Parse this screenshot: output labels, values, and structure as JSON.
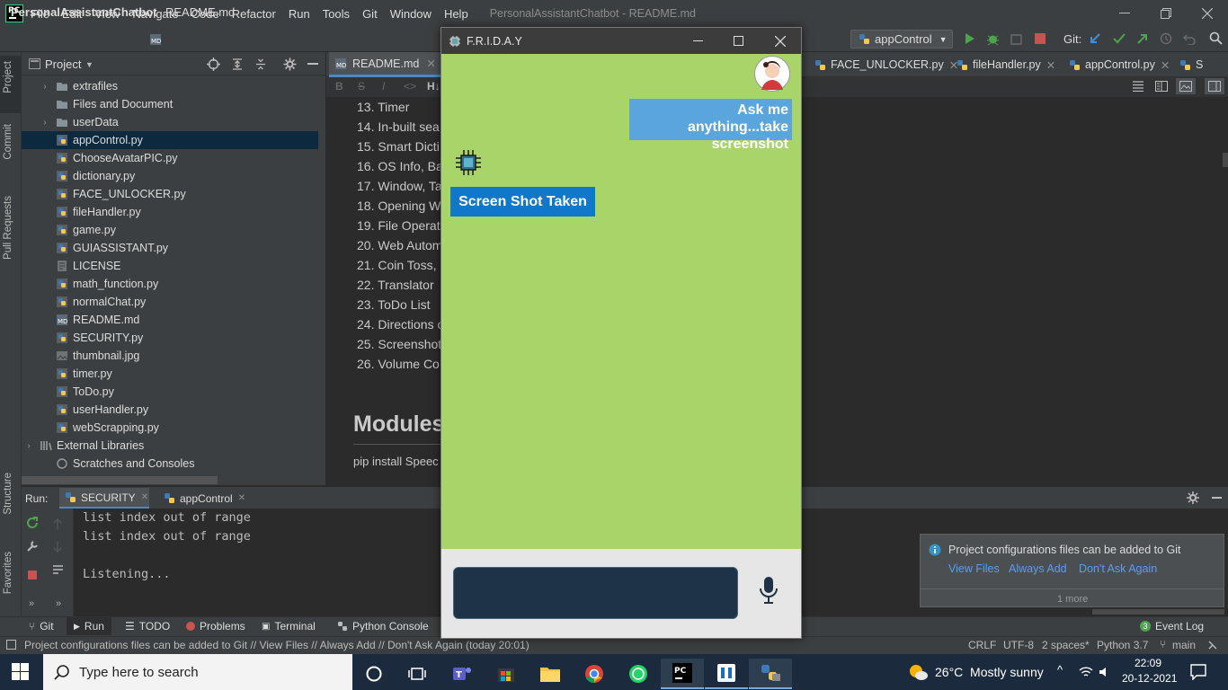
{
  "ide": {
    "menu": [
      "File",
      "Edit",
      "View",
      "Navigate",
      "Code",
      "Refactor",
      "Run",
      "Tools",
      "Git",
      "Window",
      "Help"
    ],
    "window_title": "PersonalAssistantChatbot - README.md",
    "breadcrumb_project": "PersonalAssistantChatbot",
    "breadcrumb_file": "README.md",
    "run_config": "appControl",
    "git_label": "Git:"
  },
  "left_strip": {
    "project": "Project",
    "commit": "Commit",
    "pull_requests": "Pull Requests",
    "structure": "Structure",
    "favorites": "Favorites"
  },
  "project_panel": {
    "title": "Project",
    "items": [
      {
        "name": "extrafiles",
        "type": "folder",
        "arrow": "›"
      },
      {
        "name": "Files and Document",
        "type": "folder",
        "arrow": ""
      },
      {
        "name": "userData",
        "type": "folder",
        "arrow": "›"
      },
      {
        "name": "appControl.py",
        "type": "py",
        "arrow": ""
      },
      {
        "name": "ChooseAvatarPIC.py",
        "type": "py",
        "arrow": ""
      },
      {
        "name": "dictionary.py",
        "type": "py",
        "arrow": ""
      },
      {
        "name": "FACE_UNLOCKER.py",
        "type": "py",
        "arrow": ""
      },
      {
        "name": "fileHandler.py",
        "type": "py",
        "arrow": ""
      },
      {
        "name": "game.py",
        "type": "py",
        "arrow": ""
      },
      {
        "name": "GUIASSISTANT.py",
        "type": "py",
        "arrow": ""
      },
      {
        "name": "LICENSE",
        "type": "txt",
        "arrow": ""
      },
      {
        "name": "math_function.py",
        "type": "py",
        "arrow": ""
      },
      {
        "name": "normalChat.py",
        "type": "py",
        "arrow": ""
      },
      {
        "name": "README.md",
        "type": "md",
        "arrow": ""
      },
      {
        "name": "SECURITY.py",
        "type": "py",
        "arrow": ""
      },
      {
        "name": "thumbnail.jpg",
        "type": "img",
        "arrow": ""
      },
      {
        "name": "timer.py",
        "type": "py",
        "arrow": ""
      },
      {
        "name": "ToDo.py",
        "type": "py",
        "arrow": ""
      },
      {
        "name": "userHandler.py",
        "type": "py",
        "arrow": ""
      },
      {
        "name": "webScrapping.py",
        "type": "py",
        "arrow": ""
      },
      {
        "name": "External Libraries",
        "type": "lib",
        "arrow": "›"
      },
      {
        "name": "Scratches and Consoles",
        "type": "scratch",
        "arrow": ""
      }
    ]
  },
  "editor": {
    "tabs": [
      "README.md",
      "FACE_UNLOCKER.py",
      "fileHandler.py",
      "appControl.py",
      "S"
    ],
    "md_toolbar": [
      "B",
      "S",
      "I",
      "<>",
      "H↓"
    ],
    "readme_lines": [
      "13. Timer",
      "14. In-built sea",
      "15. Smart Dicti",
      "16. OS Info, Ba",
      "17. Window, Ta",
      "18. Opening W",
      "19. File Operat",
      "20. Web Autom",
      "21. Coin Toss,",
      "22. Translator",
      "23. ToDo List",
      "24. Directions o",
      "25. Screenshot",
      "26. Volume Co"
    ],
    "heading": "Modules",
    "code_line": "pip install Speec"
  },
  "chatbot": {
    "title": "F.R.I.D.A.Y",
    "user_message": "Ask me anything...take screenshot",
    "bot_message": "Screen Shot Taken",
    "input_value": ""
  },
  "run_panel": {
    "label": "Run:",
    "tabs": [
      "SECURITY",
      "appControl"
    ],
    "console": [
      "list index out of range",
      "list index out of range",
      "",
      "Listening..."
    ]
  },
  "notification": {
    "message": "Project configurations files can be added to Git",
    "actions": [
      "View Files",
      "Always Add",
      "Don't Ask Again"
    ],
    "more": "1 more"
  },
  "tool_windows": {
    "git": "Git",
    "run": "Run",
    "todo": "TODO",
    "problems": "Problems",
    "terminal": "Terminal",
    "python_console": "Python Console",
    "event_log": "Event Log",
    "event_count": "3"
  },
  "status_bar": {
    "message": "Project configurations files can be added to Git // View Files // Always Add // Don't Ask Again (today 20:01)",
    "line_sep": "CRLF",
    "encoding": "UTF-8",
    "indent": "2 spaces*",
    "interpreter": "Python 3.7",
    "branch": "main"
  },
  "taskbar": {
    "search_placeholder": "Type here to search",
    "weather": "26°C  Mostly sunny",
    "time": "22:09",
    "date": "20-12-2021"
  },
  "colors": {
    "ide_bg": "#2b2b2b",
    "panel": "#3c3f41",
    "chat_bg": "#a8d46a",
    "user_bubble": "#5aa6dc",
    "bot_bubble": "#0f78c8",
    "taskbar": "#1b2b3d"
  }
}
